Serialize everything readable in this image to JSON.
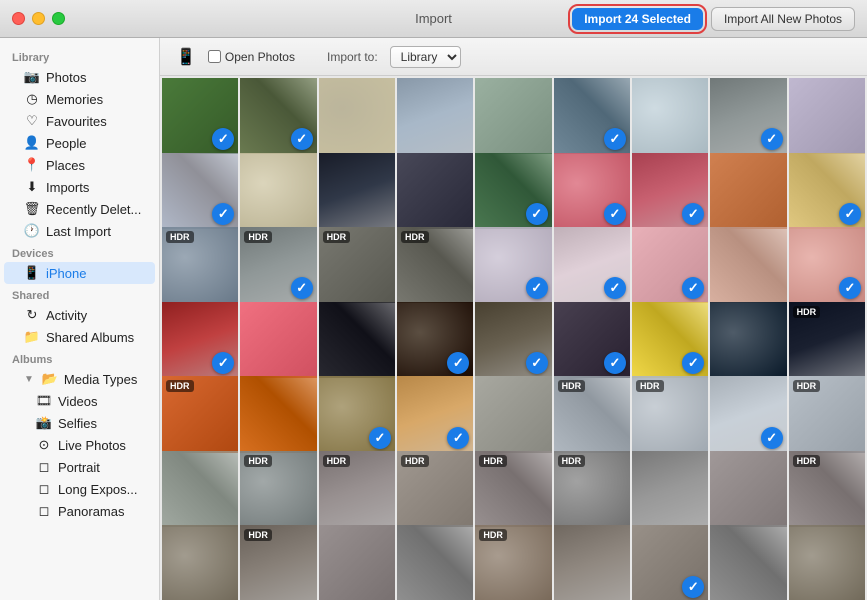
{
  "titleBar": {
    "title": "Import",
    "importSelected": "Import 24 Selected",
    "importAll": "Import All New Photos"
  },
  "toolbar": {
    "openPhotosLabel": "Open Photos",
    "importToLabel": "Import to:",
    "importToValue": "Library"
  },
  "sidebar": {
    "libraryTitle": "Library",
    "libraryItems": [
      {
        "id": "photos",
        "label": "Photos",
        "icon": "📷"
      },
      {
        "id": "memories",
        "label": "Memories",
        "icon": "◷"
      },
      {
        "id": "favourites",
        "label": "Favourites",
        "icon": "♡"
      },
      {
        "id": "people",
        "label": "People",
        "icon": "👤"
      },
      {
        "id": "places",
        "label": "Places",
        "icon": "📍"
      },
      {
        "id": "imports",
        "label": "Imports",
        "icon": "⬇"
      },
      {
        "id": "recently-deleted",
        "label": "Recently Delet...",
        "icon": "🗑"
      },
      {
        "id": "last-import",
        "label": "Last Import",
        "icon": "🕐"
      }
    ],
    "devicesTitle": "Devices",
    "devicesItems": [
      {
        "id": "iphone",
        "label": "iPhone",
        "icon": "📱",
        "active": true
      }
    ],
    "sharedTitle": "Shared",
    "sharedItems": [
      {
        "id": "activity",
        "label": "Activity",
        "icon": "↻"
      },
      {
        "id": "shared-albums",
        "label": "Shared Albums",
        "icon": "📁"
      }
    ],
    "albumsTitle": "Albums",
    "albumsItems": [
      {
        "id": "media-types",
        "label": "Media Types",
        "icon": "📂",
        "disclosure": true
      },
      {
        "id": "videos",
        "label": "Videos",
        "icon": "🎞",
        "indent": 2
      },
      {
        "id": "selfies",
        "label": "Selfies",
        "icon": "📸",
        "indent": 2
      },
      {
        "id": "live-photos",
        "label": "Live Photos",
        "icon": "⊙",
        "indent": 2
      },
      {
        "id": "portrait",
        "label": "Portrait",
        "icon": "◻",
        "indent": 2
      },
      {
        "id": "long-exposure",
        "label": "Long Expos...",
        "icon": "◻",
        "indent": 2
      },
      {
        "id": "panoramas",
        "label": "Panoramas",
        "icon": "◻",
        "indent": 2
      }
    ]
  },
  "photos": [
    {
      "id": 1,
      "color": "#4a7a3a",
      "checked": true,
      "hdr": false,
      "row": 0
    },
    {
      "id": 2,
      "color": "#8a9ab0",
      "checked": true,
      "hdr": false,
      "row": 0
    },
    {
      "id": 3,
      "color": "#b0a888",
      "checked": false,
      "hdr": false,
      "row": 0
    },
    {
      "id": 4,
      "color": "#a8b8c8",
      "checked": false,
      "hdr": false,
      "row": 0
    },
    {
      "id": 5,
      "color": "#9ab0a0",
      "checked": false,
      "hdr": false,
      "row": 0
    },
    {
      "id": 6,
      "color": "#708898",
      "checked": true,
      "hdr": false,
      "row": 0
    },
    {
      "id": 7,
      "color": "#c8d8e0",
      "checked": false,
      "hdr": false,
      "row": 0
    },
    {
      "id": 8,
      "color": "#909898",
      "checked": true,
      "hdr": false,
      "row": 0
    },
    {
      "id": 9,
      "color": "#c0b8d0",
      "checked": false,
      "hdr": false,
      "row": 0
    },
    {
      "id": 10,
      "color": "#b0b8c8",
      "checked": true,
      "hdr": false,
      "row": 1
    },
    {
      "id": 11,
      "color": "#d8d0b0",
      "checked": false,
      "hdr": false,
      "row": 1
    },
    {
      "id": 12,
      "color": "#303848",
      "checked": false,
      "hdr": false,
      "row": 1
    },
    {
      "id": 13,
      "color": "#484858",
      "checked": false,
      "hdr": false,
      "row": 1
    },
    {
      "id": 14,
      "color": "#4a7850",
      "checked": true,
      "hdr": false,
      "row": 1
    },
    {
      "id": 15,
      "color": "#e07080",
      "checked": true,
      "hdr": false,
      "row": 1
    },
    {
      "id": 16,
      "color": "#c86070",
      "checked": true,
      "hdr": false,
      "row": 1
    },
    {
      "id": 17,
      "color": "#d08050",
      "checked": false,
      "hdr": false,
      "row": 1
    },
    {
      "id": 18,
      "color": "#e0c880",
      "checked": true,
      "hdr": false,
      "row": 1
    },
    {
      "id": 19,
      "color": "#8898a8",
      "checked": false,
      "hdr": true,
      "row": 2
    },
    {
      "id": 20,
      "color": "#909898",
      "checked": true,
      "hdr": true,
      "row": 2
    },
    {
      "id": 21,
      "color": "#787870",
      "checked": false,
      "hdr": true,
      "row": 2
    },
    {
      "id": 22,
      "color": "#787870",
      "checked": false,
      "hdr": true,
      "row": 2
    },
    {
      "id": 23,
      "color": "#d0c8d8",
      "checked": true,
      "hdr": false,
      "row": 2
    },
    {
      "id": 24,
      "color": "#e0d0d8",
      "checked": true,
      "hdr": false,
      "row": 2
    },
    {
      "id": 25,
      "color": "#e8b0b8",
      "checked": true,
      "hdr": false,
      "row": 2
    },
    {
      "id": 26,
      "color": "#d8b0a0",
      "checked": false,
      "hdr": false,
      "row": 2
    },
    {
      "id": 27,
      "color": "#e8a8a0",
      "checked": true,
      "hdr": false,
      "row": 2
    },
    {
      "id": 28,
      "color": "#e05050",
      "checked": true,
      "hdr": false,
      "row": 3
    },
    {
      "id": 29,
      "color": "#f07080",
      "checked": false,
      "hdr": false,
      "row": 3
    },
    {
      "id": 30,
      "color": "#282830",
      "checked": false,
      "hdr": false,
      "row": 3
    },
    {
      "id": 31,
      "color": "#382818",
      "checked": true,
      "hdr": false,
      "row": 3
    },
    {
      "id": 32,
      "color": "#686050",
      "checked": true,
      "hdr": false,
      "row": 3
    },
    {
      "id": 33,
      "color": "#484050",
      "checked": true,
      "hdr": false,
      "row": 3
    },
    {
      "id": 34,
      "color": "#f8e870",
      "checked": true,
      "hdr": false,
      "row": 3
    },
    {
      "id": 35,
      "color": "#283848",
      "checked": false,
      "hdr": false,
      "row": 3
    },
    {
      "id": 36,
      "color": "#1a2030",
      "checked": false,
      "hdr": true,
      "row": 3
    },
    {
      "id": 37,
      "color": "#d86830",
      "checked": false,
      "hdr": true,
      "row": 4
    },
    {
      "id": 38,
      "color": "#d87020",
      "checked": false,
      "hdr": false,
      "row": 4
    },
    {
      "id": 39,
      "color": "#a09060",
      "checked": true,
      "hdr": false,
      "row": 4
    },
    {
      "id": 40,
      "color": "#d8a868",
      "checked": true,
      "hdr": false,
      "row": 4
    },
    {
      "id": 41,
      "color": "#a8a8a0",
      "checked": false,
      "hdr": false,
      "row": 4
    },
    {
      "id": 42,
      "color": "#b0b8c0",
      "checked": false,
      "hdr": true,
      "row": 4
    },
    {
      "id": 43,
      "color": "#c0c8d0",
      "checked": false,
      "hdr": true,
      "row": 4
    },
    {
      "id": 44,
      "color": "#c8d0d8",
      "checked": true,
      "hdr": false,
      "row": 4
    },
    {
      "id": 45,
      "color": "#b8c0c8",
      "checked": false,
      "hdr": true,
      "row": 4
    },
    {
      "id": 46,
      "color": "#a0a8a0",
      "checked": false,
      "hdr": false,
      "row": 5
    },
    {
      "id": 47,
      "color": "#909898",
      "checked": false,
      "hdr": true,
      "row": 5
    },
    {
      "id": 48,
      "color": "#989090",
      "checked": false,
      "hdr": true,
      "row": 5
    },
    {
      "id": 49,
      "color": "#a09890",
      "checked": false,
      "hdr": true,
      "row": 5
    },
    {
      "id": 50,
      "color": "#989090",
      "checked": false,
      "hdr": true,
      "row": 5
    },
    {
      "id": 51,
      "color": "#909090",
      "checked": false,
      "hdr": true,
      "row": 5
    },
    {
      "id": 52,
      "color": "#989898",
      "checked": false,
      "hdr": false,
      "row": 5
    },
    {
      "id": 53,
      "color": "#a09898",
      "checked": false,
      "hdr": false,
      "row": 5
    },
    {
      "id": 54,
      "color": "#989090",
      "checked": false,
      "hdr": true,
      "row": 5
    },
    {
      "id": 55,
      "color": "#908878",
      "checked": false,
      "hdr": false,
      "row": 6
    },
    {
      "id": 56,
      "color": "#888078",
      "checked": false,
      "hdr": true,
      "row": 6
    },
    {
      "id": 57,
      "color": "#989090",
      "checked": false,
      "hdr": false,
      "row": 6
    },
    {
      "id": 58,
      "color": "#909090",
      "checked": false,
      "hdr": false,
      "row": 6
    },
    {
      "id": 59,
      "color": "#988878",
      "checked": false,
      "hdr": true,
      "row": 6
    },
    {
      "id": 60,
      "color": "#908880",
      "checked": false,
      "hdr": false,
      "row": 6
    },
    {
      "id": 61,
      "color": "#989088",
      "checked": true,
      "hdr": false,
      "row": 6
    },
    {
      "id": 62,
      "color": "#909090",
      "checked": false,
      "hdr": false,
      "row": 6
    },
    {
      "id": 63,
      "color": "#908878",
      "checked": false,
      "hdr": false,
      "row": 6
    }
  ]
}
